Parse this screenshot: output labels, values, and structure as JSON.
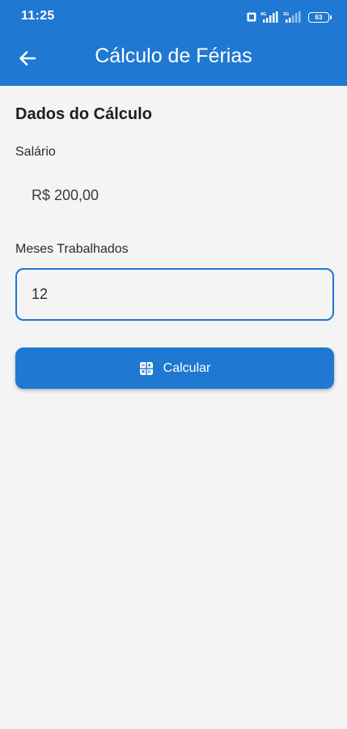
{
  "status_bar": {
    "time": "11:25",
    "network_1": "4G",
    "network_2": "3G",
    "battery_level": "63"
  },
  "app_bar": {
    "title": "Cálculo de Férias",
    "back_icon": "arrow-left-icon"
  },
  "form": {
    "section_title": "Dados do Cálculo",
    "salary_label": "Salário",
    "salary_value": "R$ 200,00",
    "months_label": "Meses Trabalhados",
    "months_value": "12",
    "calculate_label": "Calcular",
    "calculate_icon": "calculator-icon"
  },
  "colors": {
    "primary": "#1f78d1",
    "background": "#f4f4f5",
    "on_primary": "#ffffff"
  }
}
